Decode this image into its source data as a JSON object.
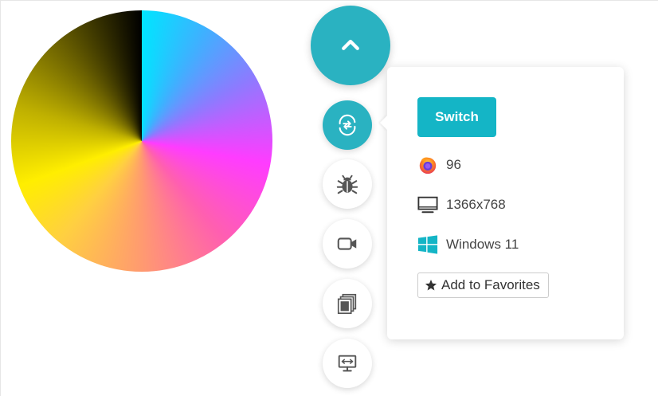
{
  "colors": {
    "accent": "#2ab2c1",
    "switch_button": "#14b5c6",
    "icon_gray": "#555555",
    "windows_blue": "#00a4ef"
  },
  "fab": {
    "main_icon": "chevron-up-icon",
    "actions": [
      {
        "name": "switch-session",
        "icon": "switch-arrows-icon",
        "active": true
      },
      {
        "name": "bug-report",
        "icon": "bug-icon",
        "active": false
      },
      {
        "name": "record-video",
        "icon": "video-camera-icon",
        "active": false
      },
      {
        "name": "screenshots",
        "icon": "gallery-icon",
        "active": false
      },
      {
        "name": "resolution",
        "icon": "monitor-resize-icon",
        "active": false
      }
    ]
  },
  "popover": {
    "switch_label": "Switch",
    "browser": {
      "icon": "firefox-icon",
      "version": "96"
    },
    "resolution": {
      "icon": "monitor-icon",
      "value": "1366x768"
    },
    "os": {
      "icon": "windows-icon",
      "value": "Windows 11"
    },
    "favorites": {
      "icon": "star-icon",
      "label": "Add to Favorites"
    }
  }
}
